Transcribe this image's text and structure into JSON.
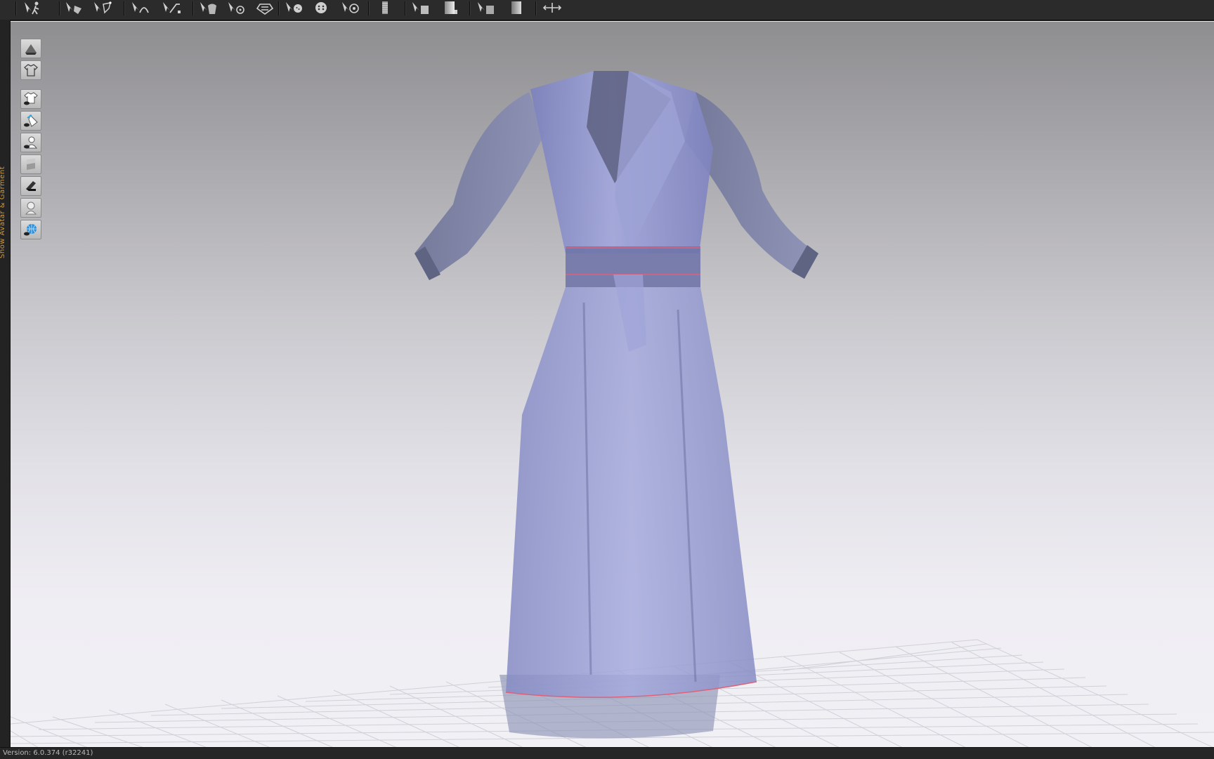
{
  "toolbar": {
    "groups": [
      [
        "simulation-icon"
      ],
      [
        "select-move-icon",
        "transform-pattern-icon"
      ],
      [
        "edit-curvature-icon",
        "edit-curve-point-icon"
      ],
      [
        "fold-arrangement-icon",
        "tack-icon",
        "pin-icon"
      ],
      [
        "button-tool-icon",
        "buttonhole-icon",
        "select-button-icon"
      ],
      [
        "zipper-icon"
      ],
      [
        "puckering-icon",
        "fabric-layer-icon"
      ],
      [
        "strengthen-icon",
        "shrinkage-icon"
      ],
      [
        "measure-icon"
      ]
    ]
  },
  "left_strip": {
    "vertical_label": "Show Avatar & Garment"
  },
  "side_tools": [
    {
      "name": "show-3d-pen-icon"
    },
    {
      "name": "show-garment-icon"
    },
    {
      "name": "show-garment-visibility-icon"
    },
    {
      "name": "show-pattern-visibility-icon"
    },
    {
      "name": "show-avatar-visibility-icon"
    },
    {
      "name": "texture-surface-icon"
    },
    {
      "name": "thickness-render-icon"
    },
    {
      "name": "show-avatar-icon"
    },
    {
      "name": "environment-icon"
    }
  ],
  "viewport": {
    "background_top": "#8e8d90",
    "background_bottom": "#f1f0f5",
    "garment_color": "#8e93c9",
    "seam_color": "#e0607a",
    "grid_color": "#cfcfd6"
  },
  "statusbar": {
    "text": "Version: 6.0.374 (r32241)"
  }
}
